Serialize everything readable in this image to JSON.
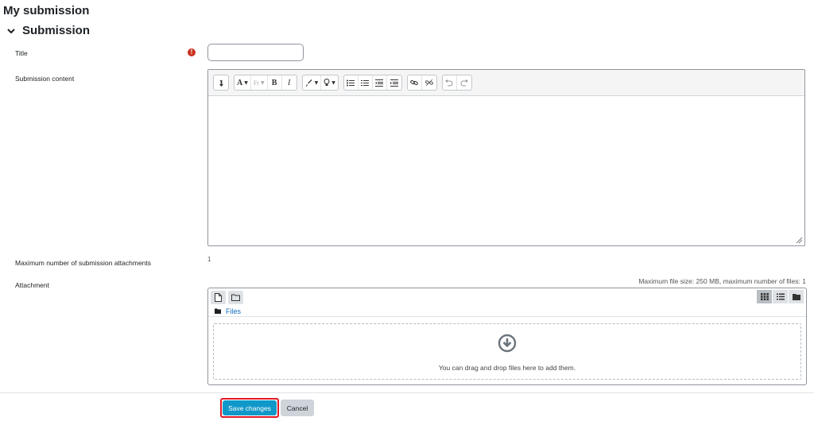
{
  "page": {
    "heading": "My submission"
  },
  "section": {
    "title": "Submission"
  },
  "fields": {
    "title_label": "Title",
    "title_value": "",
    "content_label": "Submission content",
    "max_attachments_label": "Maximum number of submission attachments",
    "max_attachments_value": "1",
    "attachment_label": "Attachment"
  },
  "editor": {
    "toolbar_groups": [
      [
        "collapse-icon"
      ],
      [
        "font-style-icon",
        "font-family-icon",
        "bold-icon",
        "italic-icon"
      ],
      [
        "paint-brush-icon",
        "lightbulb-icon"
      ],
      [
        "unordered-list-icon",
        "ordered-list-icon",
        "outdent-icon",
        "indent-icon"
      ],
      [
        "link-icon",
        "unlink-icon"
      ],
      [
        "undo-icon",
        "redo-icon"
      ]
    ],
    "bold": "B",
    "italic": "I",
    "font_style": "A",
    "font_family": "Fr"
  },
  "filepicker": {
    "limits": "Maximum file size: 250 MB, maximum number of files: 1",
    "path_link": "Files",
    "drop_text": "You can drag and drop files here to add them."
  },
  "actions": {
    "save": "Save changes",
    "cancel": "Cancel"
  },
  "colors": {
    "primary_button": "#0f98c8",
    "required_icon": "#ca3120",
    "highlight_border": "#e01b24",
    "link": "#0f6cbf"
  }
}
